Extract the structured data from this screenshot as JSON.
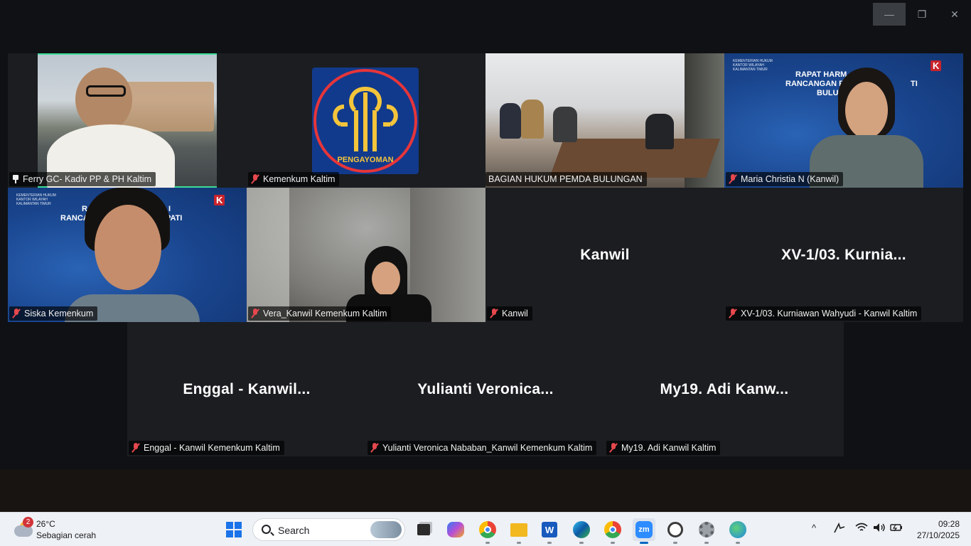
{
  "window": {
    "controls": {
      "minimize": "—",
      "maximize": "❐",
      "close": "✕"
    }
  },
  "grid": {
    "tiles": [
      {
        "name": "Ferry GC- Kadiv PP & PH Kaltim",
        "type": "video",
        "pinned": true,
        "active_speaker": true
      },
      {
        "name": "Kemenkum Kaltim",
        "type": "logo",
        "muted": true,
        "logo_text": "PENGAYOMAN"
      },
      {
        "name": "BAGIAN HUKUM PEMDA BULUNGAN",
        "type": "video"
      },
      {
        "name": "Maria Christia N (Kanwil)",
        "type": "video",
        "muted": true,
        "banner_line1": "RAPAT HARM",
        "banner_line1b": "TI",
        "banner_line2": "RANCANGAN PER",
        "banner_line3": "BULU",
        "banner_org": "KEMENTERIAN HUKUM",
        "banner_org2": "KANTOR WILAYAH",
        "banner_org3": "KALIMANTAN TIMUR"
      },
      {
        "name": "Siska Kemenkum",
        "type": "video",
        "muted": true,
        "banner_line1": "RAP",
        "banner_line1b": "I",
        "banner_line2": "RANCANGAN",
        "banner_line2b": "UPATI",
        "banner_org": "KEMENTERIAN HUKUM",
        "banner_org2": "KANTOR WILAYAH",
        "banner_org3": "KALIMANTAN TIMUR"
      },
      {
        "name": "Vera_Kanwil Kemenkum Kaltim",
        "type": "video",
        "muted": true
      },
      {
        "name": "Kanwil",
        "type": "no-video",
        "display_name": "Kanwil",
        "muted": true
      },
      {
        "name": "XV-1/03. Kurniawan Wahyudi - Kanwil Kaltim",
        "type": "no-video",
        "display_name": "XV-1/03. Kurnia...",
        "muted": true
      },
      {
        "name": "Enggal - Kanwil Kemenkum Kaltim",
        "type": "no-video",
        "display_name": "Enggal - Kanwil...",
        "muted": true
      },
      {
        "name": "Yulianti Veronica Nababan_Kanwil Kemenkum Kaltim",
        "type": "no-video",
        "display_name": "Yulianti Veronica...",
        "muted": true
      },
      {
        "name": "My19. Adi Kanwil Kaltim",
        "type": "no-video",
        "display_name": "My19. Adi Kanw...",
        "muted": true
      }
    ]
  },
  "taskbar": {
    "weather": {
      "badge": "2",
      "temp": "26°C",
      "desc": "Sebagian cerah"
    },
    "search": {
      "placeholder": "Search"
    },
    "apps": [
      "start-icon",
      "task-view-icon",
      "copilot-icon",
      "chrome-icon",
      "file-explorer-icon",
      "word-icon",
      "edge-icon",
      "chrome-profile-icon",
      "zoom-icon",
      "clock-app-icon",
      "settings-icon",
      "maps-icon"
    ],
    "zoom_label": "zm",
    "tray": {
      "chevron": "^",
      "wifi": "wifi",
      "volume": "volume",
      "battery": "battery"
    },
    "clock": {
      "time": "09:28",
      "date": "27/10/2025"
    }
  },
  "colors": {
    "active_outline": "#3ddc97",
    "muted_red": "#e5484d",
    "taskbar_bg": "#eef1f6"
  }
}
